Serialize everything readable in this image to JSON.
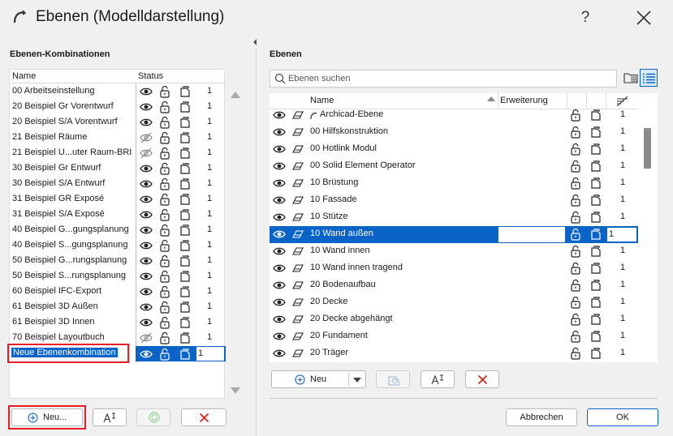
{
  "window": {
    "title": "Ebenen (Modelldarstellung)",
    "help_label": "?"
  },
  "left": {
    "title": "Ebenen-Kombinationen",
    "col_name": "Name",
    "col_status": "Status",
    "rows": [
      {
        "name": "00 Arbeitseinstellung",
        "visible": true,
        "num": "1"
      },
      {
        "name": "20 Beispiel Gr Vorentwurf",
        "visible": true,
        "num": "1"
      },
      {
        "name": "20 Beispiel S/A Vorentwurf",
        "visible": true,
        "num": "1"
      },
      {
        "name": "21 Beispiel Räume",
        "visible": false,
        "num": "1"
      },
      {
        "name": "21 Beispiel U...uter Raum-BRI",
        "visible": false,
        "num": "1"
      },
      {
        "name": "30 Beispiel Gr Entwurf",
        "visible": true,
        "num": "1"
      },
      {
        "name": "30 Beispiel S/A Entwurf",
        "visible": true,
        "num": "1"
      },
      {
        "name": "31 Beispiel GR Exposé",
        "visible": true,
        "num": "1"
      },
      {
        "name": "31 Beispiel S/A Exposé",
        "visible": true,
        "num": "1"
      },
      {
        "name": "40 Beispiel G...gungsplanung",
        "visible": true,
        "num": "1"
      },
      {
        "name": "40 Beispiel S...gungsplanung",
        "visible": true,
        "num": "1"
      },
      {
        "name": "50 Beispiel G...rungsplanung",
        "visible": true,
        "num": "1"
      },
      {
        "name": "50 Beispiel S...rungsplanung",
        "visible": true,
        "num": "1"
      },
      {
        "name": "60 Beispiel IFC-Export",
        "visible": true,
        "num": "1"
      },
      {
        "name": "61 Beispiel 3D Außen",
        "visible": true,
        "num": "1"
      },
      {
        "name": "61 Beispiel 3D Innen",
        "visible": true,
        "num": "1"
      },
      {
        "name": "70 Beispiel Layoutbuch",
        "visible": false,
        "num": "1"
      }
    ],
    "new_row": {
      "name": "Neue Ebenenkombination",
      "num": "1"
    },
    "new_button_label": "Neu..."
  },
  "right": {
    "title": "Ebenen",
    "search_placeholder": "Ebenen suchen",
    "col_name": "Name",
    "col_ext": "Erweiterung",
    "rows": [
      {
        "name": "Archicad-Ebene",
        "num": "1",
        "special": true
      },
      {
        "name": "00 Hilfskonstruktion",
        "num": "1"
      },
      {
        "name": "00 Hotlink Modul",
        "num": "1"
      },
      {
        "name": "00 Solid Element Operator",
        "num": "1"
      },
      {
        "name": "10 Brüstung",
        "num": "1"
      },
      {
        "name": "10 Fassade",
        "num": "1"
      },
      {
        "name": "10 Stütze",
        "num": "1"
      },
      {
        "name": "10 Wand außen",
        "num": "1",
        "selected": true
      },
      {
        "name": "10 Wand innen",
        "num": "1"
      },
      {
        "name": "10 Wand innen tragend",
        "num": "1"
      },
      {
        "name": "20 Bodenaufbau",
        "num": "1"
      },
      {
        "name": "20 Decke",
        "num": "1"
      },
      {
        "name": "20 Decke abgehängt",
        "num": "1"
      },
      {
        "name": "20 Fundament",
        "num": "1"
      },
      {
        "name": "20 Träger",
        "num": "1"
      }
    ],
    "new_button_label": "Neu"
  },
  "footer": {
    "cancel_label": "Abbrechen",
    "ok_label": "OK"
  },
  "colors": {
    "selection": "#0a64c8",
    "highlight_red": "#e81c24",
    "delete_red": "#d9261c",
    "add_blue": "#2e73c9"
  }
}
